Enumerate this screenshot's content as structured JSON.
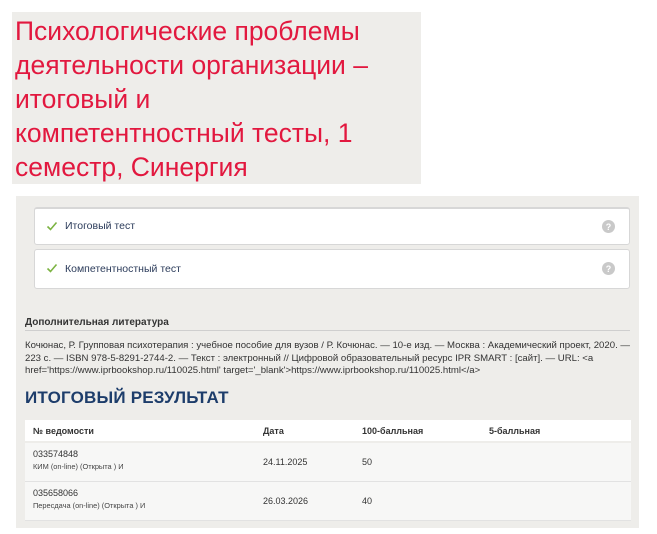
{
  "title": "Психологические проблемы\nдеятельности организации –\nитоговый и\nкомпетентностный тесты, 1\nсеместр, Синергия",
  "tests": [
    {
      "label": "Итоговый тест",
      "help": "?"
    },
    {
      "label": "Компетентностный тест",
      "help": "?"
    }
  ],
  "literature": {
    "heading": "Дополнительная литература",
    "text": "Кочюнас, Р. Групповая психотерапия : учебное пособие для вузов / Р. Кочюнас. — 10-е изд. — Москва : Академический проект, 2020. — 223 с. — ISBN 978-5-8291-2744-2. — Текст : электронный // Цифровой образовательный ресурс IPR SMART : [сайт]. — URL: <a href='https://www.iprbookshop.ru/110025.html' target='_blank'>https://www.iprbookshop.ru/110025.html</a>"
  },
  "result": {
    "heading": "ИТОГОВЫЙ РЕЗУЛЬТАТ",
    "columns": [
      "№ ведомости",
      "Дата",
      "100-балльная",
      "5-балльная"
    ],
    "rows": [
      {
        "number": "033574848",
        "type": "КИМ (on-line) (Открыта ) И",
        "date": "24.11.2025",
        "score100": "50",
        "score5": ""
      },
      {
        "number": "035658066",
        "type": "Пересдача (on-line) (Открыта ) И",
        "date": "26.03.2026",
        "score100": "40",
        "score5": ""
      }
    ]
  },
  "colors": {
    "title": "#e2183f",
    "heading": "#1d3d6b",
    "check": "#7cb342",
    "panel": "#eeedea"
  }
}
